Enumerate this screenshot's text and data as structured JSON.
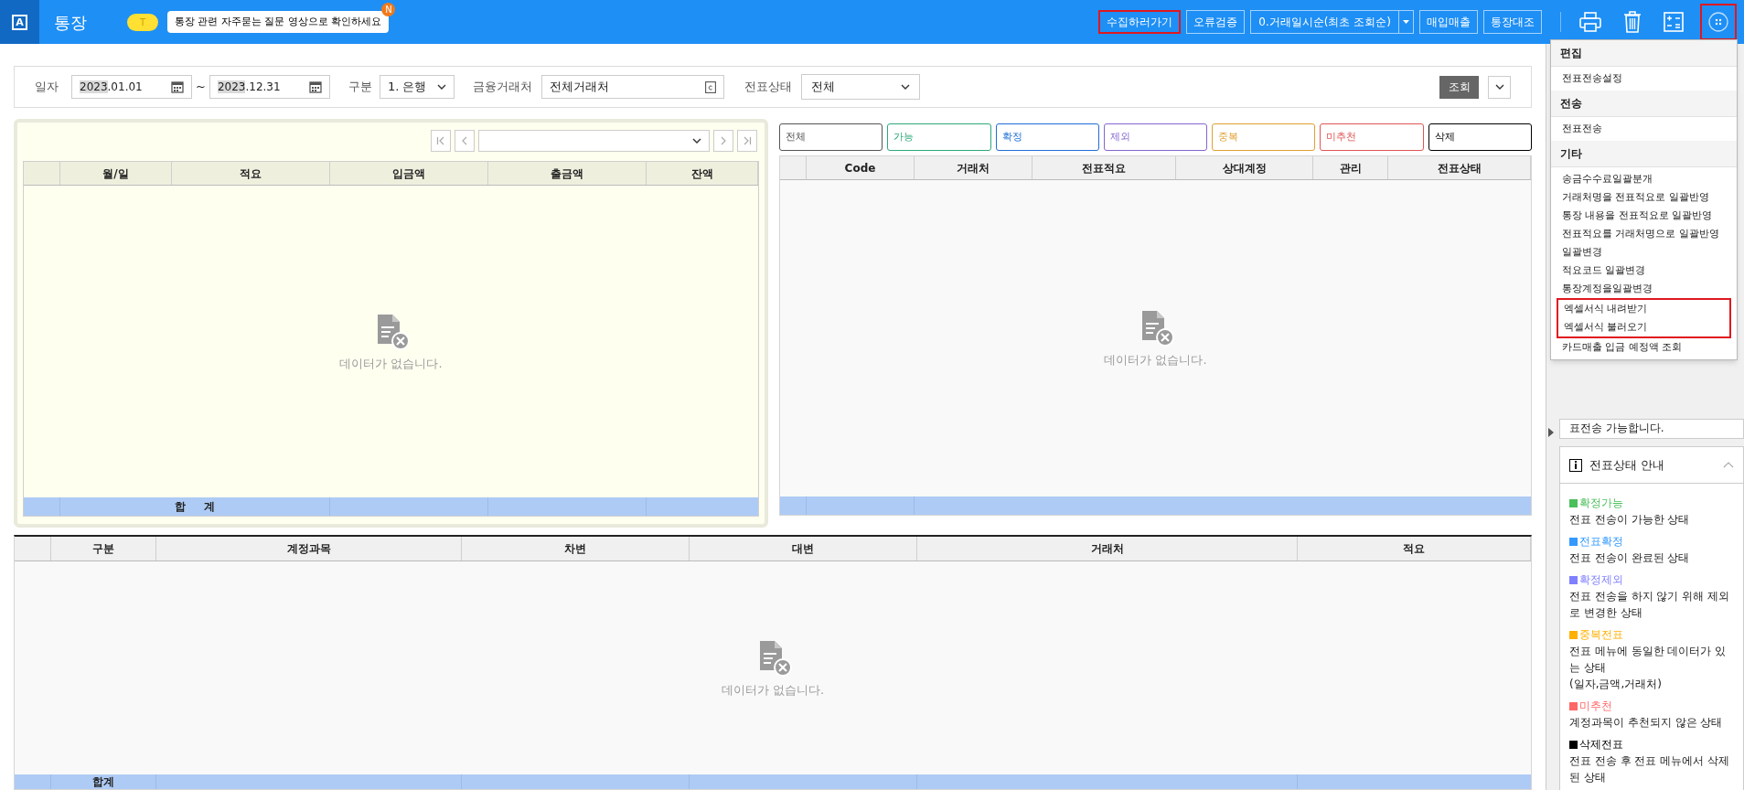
{
  "header": {
    "logo": "A",
    "title": "통장",
    "badge": "T",
    "notice": "통장 관련 자주묻는 질문 영상으로 확인하세요",
    "notice_dot": "N",
    "buttons": [
      {
        "kind": "button",
        "label": "수집하러가기",
        "highlighted": true
      },
      {
        "kind": "button",
        "label": "오류검증",
        "highlighted": false
      },
      {
        "kind": "dropdown",
        "label": "0.거래일시순(최초 조회순)",
        "highlighted": false
      },
      {
        "kind": "button",
        "label": "매입매출",
        "highlighted": false
      },
      {
        "kind": "button",
        "label": "통장대조",
        "highlighted": false
      }
    ],
    "more_highlighted": true
  },
  "filters": {
    "date_label": "일자",
    "date_from": "2023.01.01",
    "date_sep": "~",
    "date_to": "2023.12.31",
    "type_label": "구분",
    "type_value": "1. 은행",
    "partner_label": "금융거래처",
    "partner_value": "전체거래처",
    "status_label": "전표상태",
    "status_value": "전체",
    "search_button": "조회"
  },
  "left_table": {
    "columns": [
      "월/일",
      "적요",
      "입금액",
      "출금액",
      "잔액"
    ],
    "empty": "데이터가 없습니다.",
    "footer": "합     계"
  },
  "chips": [
    {
      "label": "전체",
      "color": "#555555"
    },
    {
      "label": "가능",
      "color": "#2eaa7a"
    },
    {
      "label": "확정",
      "color": "#1f6fd6"
    },
    {
      "label": "제외",
      "color": "#8566d0"
    },
    {
      "label": "중복",
      "color": "#e0a030"
    },
    {
      "label": "미추천",
      "color": "#e05555"
    },
    {
      "label": "삭제",
      "color": "#000000"
    }
  ],
  "right_table": {
    "columns": [
      "Code",
      "거래처",
      "전표적요",
      "상대계정",
      "관리",
      "전표상태"
    ],
    "empty": "데이터가 없습니다."
  },
  "bottom_table": {
    "columns": [
      "구분",
      "계정과목",
      "차변",
      "대변",
      "거래처",
      "적요"
    ],
    "empty": "데이터가 없습니다.",
    "footer": "합계"
  },
  "side_panel": {
    "note": "표전송 가능합니다.",
    "info_title": "전표상태 안내",
    "legend": [
      {
        "name": "확정가능",
        "color": "#4cbf5a",
        "desc": "전표 전송이 가능한 상태"
      },
      {
        "name": "전표확정",
        "color": "#3399ff",
        "desc": "전표 전송이 완료된 상태"
      },
      {
        "name": "확정제외",
        "color": "#8080ff",
        "desc": "전표 전송을 하지 않기 위해 제외로 변경한 상태"
      },
      {
        "name": "중복전표",
        "color": "#ffb000",
        "desc": "전표 메뉴에 동일한 데이터가 있는 상태\n(일자,금액,거래처)"
      },
      {
        "name": "미추천",
        "color": "#ff6666",
        "desc": "계정과목이 추천되지 않은 상태"
      },
      {
        "name": "삭제전표",
        "color": "#000000",
        "desc": "전표 전송 후 전표 메뉴에서 삭제된 상태"
      }
    ]
  },
  "menu": {
    "sections": [
      {
        "title": "편집",
        "items": [
          {
            "label": "전표전송설정",
            "highlighted": false
          }
        ]
      },
      {
        "title": "전송",
        "items": [
          {
            "label": "전표전송",
            "highlighted": false
          }
        ]
      },
      {
        "title": "기타",
        "items": [
          {
            "label": "송금수수료일괄분개",
            "highlighted": false
          },
          {
            "label": "거래처명을 전표적요로 일괄반영",
            "highlighted": false
          },
          {
            "label": "통장 내용을 전표적요로 일괄반영",
            "highlighted": false
          },
          {
            "label": "전표적요를 거래처명으로 일괄반영",
            "highlighted": false
          },
          {
            "label": "일괄변경",
            "highlighted": false
          },
          {
            "label": "적요코드 일괄변경",
            "highlighted": false
          },
          {
            "label": "통장계정을일괄변경",
            "highlighted": false
          },
          {
            "label": "엑셀서식 내려받기",
            "highlighted": true
          },
          {
            "label": "엑셀서식 불러오기",
            "highlighted": true
          },
          {
            "label": "카드매출 입금 예정액 조회",
            "highlighted": false
          }
        ]
      }
    ]
  }
}
